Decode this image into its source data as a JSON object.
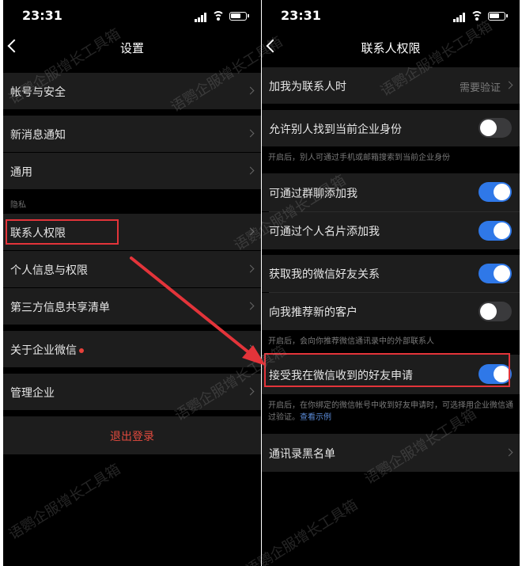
{
  "status_bar": {
    "time": "23:31"
  },
  "colors": {
    "accent_blue": "#2f78e8",
    "highlight_red": "#e3343a",
    "logout_red": "#e14a3e",
    "row_bg": "#1d1d1d"
  },
  "settings": {
    "title": "设置",
    "items": [
      {
        "label": "帐号与安全"
      },
      {
        "label": "新消息通知"
      },
      {
        "label": "通用"
      },
      {
        "label": "联系人权限"
      },
      {
        "label": "个人信息与权限"
      },
      {
        "label": "第三方信息共享清单"
      },
      {
        "label": "关于企业微信"
      },
      {
        "label": "管理企业"
      }
    ],
    "privacy_label": "隐私",
    "logout_label": "退出登录"
  },
  "contact_permission": {
    "title": "联系人权限",
    "add_me": {
      "label": "加我为联系人时",
      "value": "需要验证"
    },
    "find_me": {
      "label": "允许别人找到当前企业身份",
      "enabled": false
    },
    "find_me_note": "开启后，别人可通过手机或邮箱搜索到当前企业身份",
    "add_via_group": {
      "label": "可通过群聊添加我",
      "enabled": true
    },
    "add_via_card": {
      "label": "可通过个人名片添加我",
      "enabled": true
    },
    "get_wechat_friends": {
      "label": "获取我的微信好友关系",
      "enabled": true
    },
    "recommend_customers": {
      "label": "向我推荐新的客户",
      "enabled": false
    },
    "recommend_note": "开启后，会向你推荐微信通讯录中的外部联系人",
    "accept_wechat_requests": {
      "label": "接受我在微信收到的好友申请",
      "enabled": true
    },
    "accept_note": "开启后，在你绑定的微信帐号中收到好友申请时，可选择用企业微信通过验证。",
    "accept_note_link": "查看示例",
    "blacklist": {
      "label": "通讯录黑名单"
    }
  },
  "watermark_text": "语鹦企服增长工具箱"
}
